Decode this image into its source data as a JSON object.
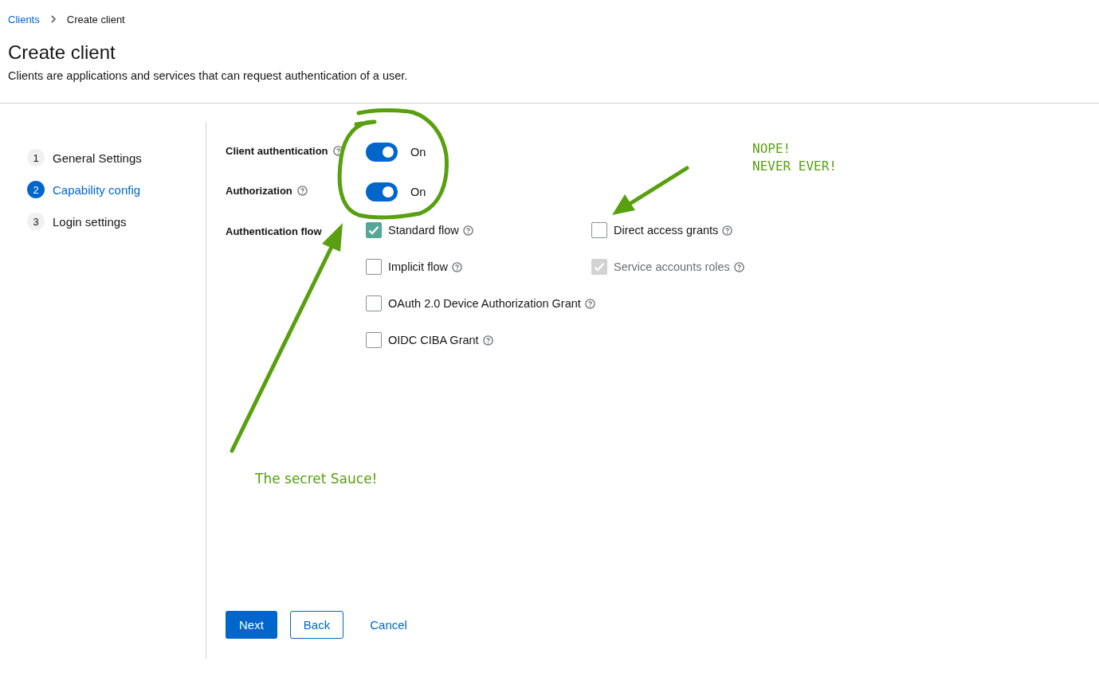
{
  "breadcrumb": [
    {
      "label": "Clients",
      "kind": "link"
    },
    {
      "label": "Create client",
      "kind": "current"
    }
  ],
  "page": {
    "title": "Create client",
    "description": "Clients are applications and services that can request authentication of a user."
  },
  "steps": [
    {
      "number": "1",
      "label": "General Settings",
      "selected": false
    },
    {
      "number": "2",
      "label": "Capability config",
      "selected": true
    },
    {
      "number": "3",
      "label": "Login settings",
      "selected": false
    }
  ],
  "toggles": [
    {
      "label": "Client authentication",
      "on": true,
      "state_text": "On"
    },
    {
      "label": "Authorization",
      "on": true,
      "state_text": "On"
    }
  ],
  "authentication_flow": {
    "label": "Authentication flow",
    "rows": [
      [
        {
          "label": "Standard flow",
          "checked": true,
          "disabled": false
        },
        {
          "label": "Direct access grants",
          "checked": false,
          "disabled": false
        }
      ],
      [
        {
          "label": "Implicit flow",
          "checked": false,
          "disabled": false
        },
        {
          "label": "Service accounts roles",
          "checked": true,
          "disabled": true
        }
      ],
      [
        {
          "label": "OAuth 2.0 Device Authorization Grant",
          "checked": false,
          "disabled": false
        }
      ],
      [
        {
          "label": "OIDC CIBA Grant",
          "checked": false,
          "disabled": false
        }
      ]
    ]
  },
  "buttons": [
    {
      "label": "Next",
      "kind": "primary"
    },
    {
      "label": "Back",
      "kind": "secondary"
    },
    {
      "label": "Cancel",
      "kind": "link"
    }
  ],
  "annotations": {
    "note_upper": "NOPE!\nNEVER EVER!",
    "note_lower": "The secret Sauce!"
  }
}
